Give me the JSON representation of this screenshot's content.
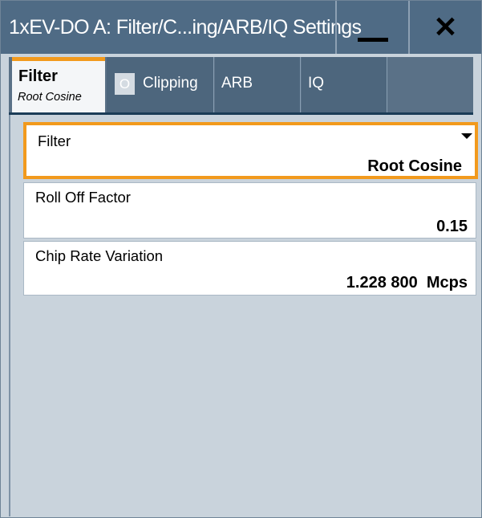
{
  "window": {
    "title": "1xEV-DO A: Filter/C...ing/ARB/IQ Settings",
    "minimize_icon": "minimize-icon",
    "close_icon": "close-icon"
  },
  "tabs": {
    "filter": {
      "label": "Filter",
      "sublabel": "Root Cosine"
    },
    "clipping": {
      "label": "Clipping",
      "badge": "O"
    },
    "arb": {
      "label": "ARB"
    },
    "iq": {
      "label": "IQ"
    }
  },
  "fields": {
    "filter": {
      "label": "Filter",
      "value": "Root Cosine",
      "icon": "dropdown-arrow-icon"
    },
    "roll_off_factor": {
      "label": "Roll Off Factor",
      "value": "0.15"
    },
    "chip_rate_variation": {
      "label": "Chip Rate Variation",
      "value": "1.228 800  Mcps"
    }
  },
  "colors": {
    "titlebar": "#4f6b85",
    "accent": "#f29a1d",
    "panel": "#c9d3dc"
  }
}
